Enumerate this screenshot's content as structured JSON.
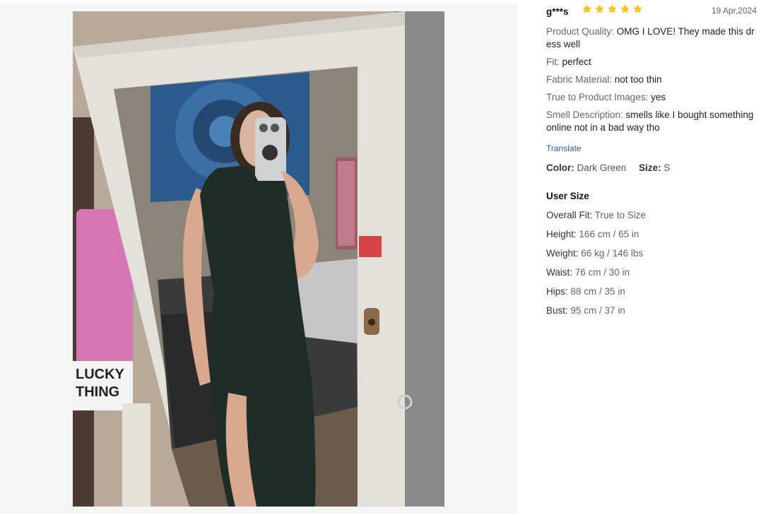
{
  "review": {
    "user": "g***s",
    "rating": 5,
    "date": "19 Apr,2024",
    "attributes": [
      {
        "label": "Product Quality:",
        "value": " OMG I LOVE! They made this dress well"
      },
      {
        "label": "Fit:",
        "value": " perfect"
      },
      {
        "label": "Fabric Material:",
        "value": " not too thin"
      },
      {
        "label": "True to Product Images:",
        "value": " yes"
      },
      {
        "label": "Smell Description:",
        "value": " smells like I bought something online not in a bad way tho"
      }
    ],
    "translate_label": "Translate",
    "color_label": "Color:",
    "color_value": "Dark Green",
    "size_label": "Size:",
    "size_value": "S",
    "user_size_title": "User Size",
    "user_size": [
      {
        "label": "Overall Fit:",
        "value": "True to Size"
      },
      {
        "label": "Height:",
        "value": "166 cm / 65 in"
      },
      {
        "label": "Weight:",
        "value": "66 kg / 146 lbs"
      },
      {
        "label": "Waist:",
        "value": "76 cm / 30 in"
      },
      {
        "label": "Hips:",
        "value": "88 cm / 35 in"
      },
      {
        "label": "Bust:",
        "value": "95 cm / 37 in"
      }
    ]
  },
  "colors": {
    "star": "#f5c518",
    "link": "#2a5fa8",
    "dress": "#1f2d26"
  },
  "icons": {
    "star": "star-icon"
  }
}
